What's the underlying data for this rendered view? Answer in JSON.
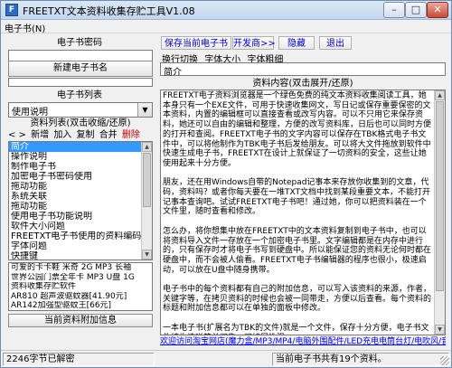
{
  "window": {
    "title": "FREETXT文本资料收集存贮工具V1.08",
    "app_icon": "F",
    "controls": {
      "minimize": "–",
      "maximize": "□",
      "close": "✕"
    }
  },
  "menubar": {
    "items": [
      "电子书(N)"
    ]
  },
  "left": {
    "password_label": "电子书密码",
    "new_book_button": "新建电子书名",
    "book_list_label": "电子书列表",
    "selected_book": "使用说明",
    "material_list_header": "资料列表(双击收缩/还原)",
    "toolbar": {
      "nav": "<  >",
      "new": "新增",
      "add": "加入",
      "copy": "复制",
      "merge": "合并",
      "delete": "删除"
    },
    "items": [
      "简介",
      "操作说明",
      "制作电子书",
      "加密电子书密码使用",
      "拖动功能",
      "系统关联",
      "拖动功能",
      "使用电子书功能说明",
      "软件大小问题",
      "FREETXT电子书使用的资料编码问题",
      "字体问题",
      "快捷键"
    ],
    "selected_index": 0,
    "info_lines": [
      "可爱的卡卡鞋 米奇 2G MP3 长袖",
      "世界公园门票全年卡 MP3 U盘 1G",
      "资料收集存贮软件",
      "AR810 超声波驱蚊器[41.90元]",
      "AR142加强型驱蚊王[66元]",
      "精华电筒合作[实手工]系列产品"
    ],
    "attach_label": "当前资料附加信息"
  },
  "right": {
    "buttons": {
      "save": "保存当前电子书",
      "open": "开发商>>",
      "hide": "隐藏",
      "exit": "退出"
    },
    "tool_row": [
      "换行切换",
      "字体大小",
      "字体粗细"
    ],
    "current_name": "简介",
    "content_label": "资料内容(双击展开/还原)",
    "content_text": "FREETXT电子资料浏览器是一个绿色免费的纯文本资料收集阅读工具，她本身只有一个EXE文件，可用于快速收集网文，写日记或保存重要保密的文本资料，内置的编辑框可以直接查看或改写内容。可以不只用它来保存资料，她还可以自由的编辑和整理，方便的改写资料库，日后也可以同时方便的打开和查阅。FREETXT电子书的文字内容可以保存在TBK格式电子书文件中，可以将他制作为TBK电子书后发给朋友。可以将大文件拖放到软件中快速生成电子书，FREETXT在设计上就保证了一切资料的安全，这些让她使用起来十分方便。\n\n朋友，还在用Windows自带的Notepad记事本来存放你收集到的文章，代码，资料吗？或者你每天要在一堆TXT文档中找到某段重要文本，不能打开记事本查询吧。试试FREETXT电子书吧！通过她，你可以把资料装在一个文件里，随时查看和修改。\n\n怎么办，将你想集中放在FREETXT中的文本资料复制到电子书中，也可以将资料导入文件一存放在一个加密电子书里。文字编辑都是在内存中进行的，只有保存时才将电子书写到硬盘中。所以能保证您的资料无论何时都在硬盘中，而不会被人偷看。FREETXT电子书编辑器的程序也很小，极速启动，可以放在U盘中随身携带。\n\n电子书中的每个资料都有自己的附加信息，可以写入该资料的来源，作者，关键字等，在拷贝资料的时候也会被一同带走，方便以后查看。每个资料的标题和附加信息都可以在单独的面板中修改。\n\n一本电子书(扩展名为TBK的文件)就是一个文件，保存十分方便，电子书文件结构清晰简单可靠，可扩展性强。",
    "footer_link": "欢迎访问淘宝网店(魔力盒/MP3/MP4/电脑外围配件/LED充电电筒台灯/电吹风/音箱耳机)"
  },
  "status": {
    "left": "2246字节已解密",
    "right": "当前电子书共有19个资料。"
  }
}
